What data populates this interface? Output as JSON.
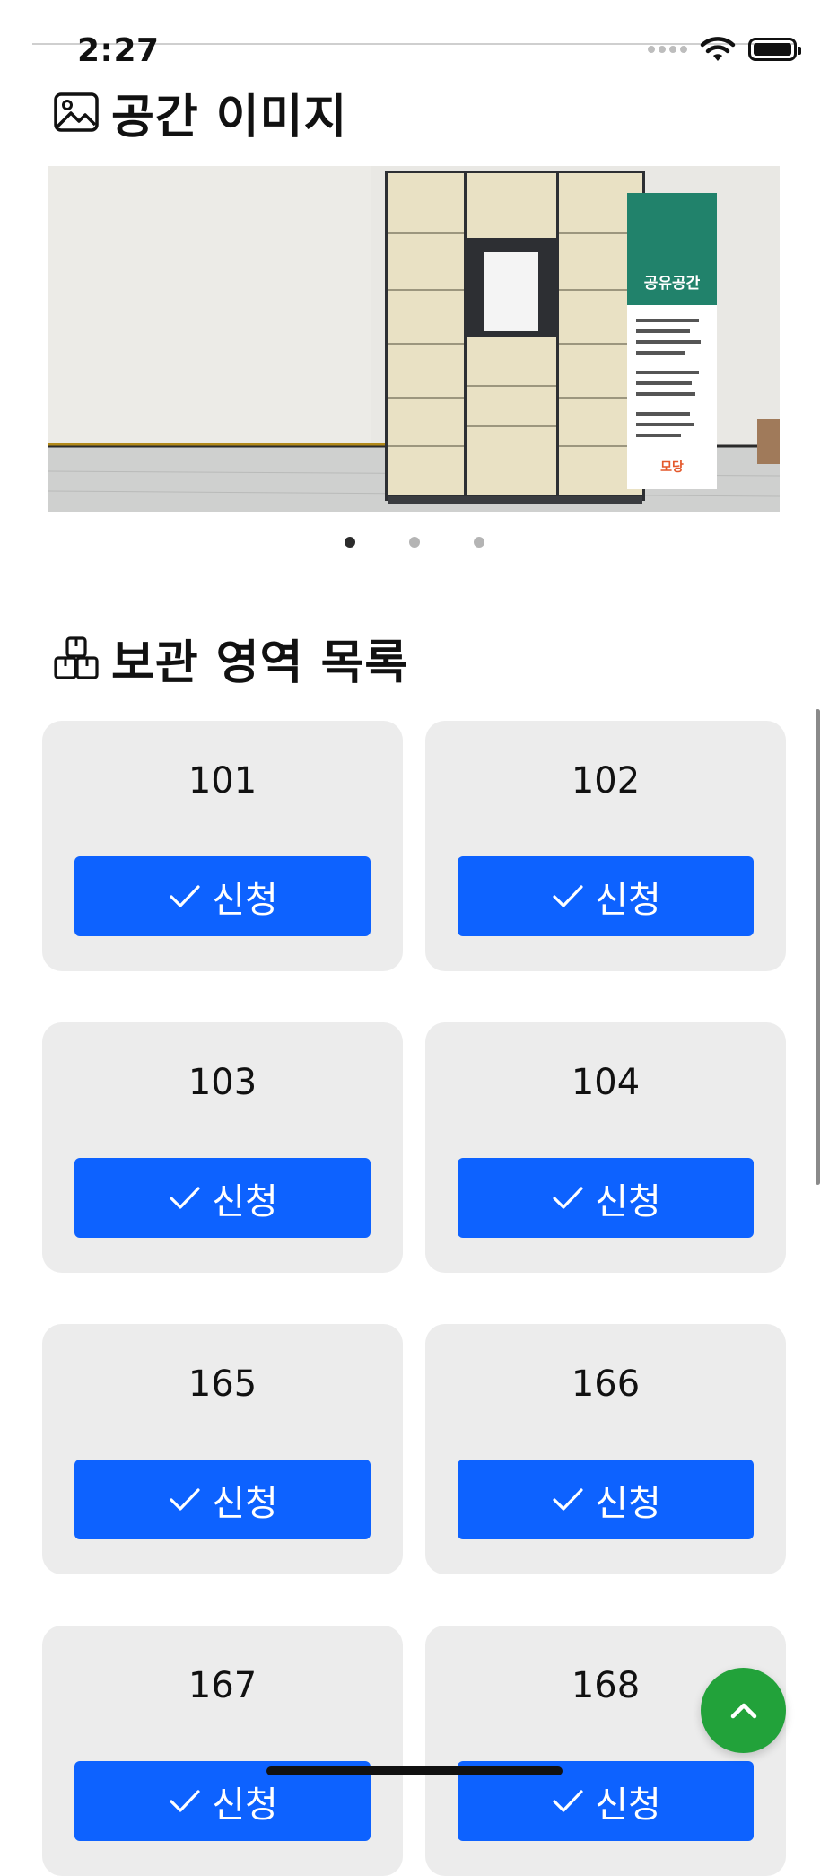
{
  "status_bar": {
    "time": "2:27",
    "icons": [
      "signal-icon",
      "wifi-icon",
      "battery-icon"
    ]
  },
  "image_section": {
    "icon": "image-icon",
    "title": "공간 이미지"
  },
  "carousel": {
    "slide_count": 3,
    "active_index": 0,
    "poster_text": "공유공간",
    "brand_text": "모당"
  },
  "list_section": {
    "icon": "boxes-icon",
    "title": "보관 영역 목록"
  },
  "storage_areas": [
    {
      "number": "101",
      "button_label": "신청"
    },
    {
      "number": "102",
      "button_label": "신청"
    },
    {
      "number": "103",
      "button_label": "신청"
    },
    {
      "number": "104",
      "button_label": "신청"
    },
    {
      "number": "165",
      "button_label": "신청"
    },
    {
      "number": "166",
      "button_label": "신청"
    },
    {
      "number": "167",
      "button_label": "신청"
    },
    {
      "number": "168",
      "button_label": "신청"
    }
  ],
  "colors": {
    "primary": "#0d62ff",
    "card_bg": "#ececec",
    "fab": "#22a23a"
  },
  "fab": {
    "icon": "chevron-up-icon"
  }
}
